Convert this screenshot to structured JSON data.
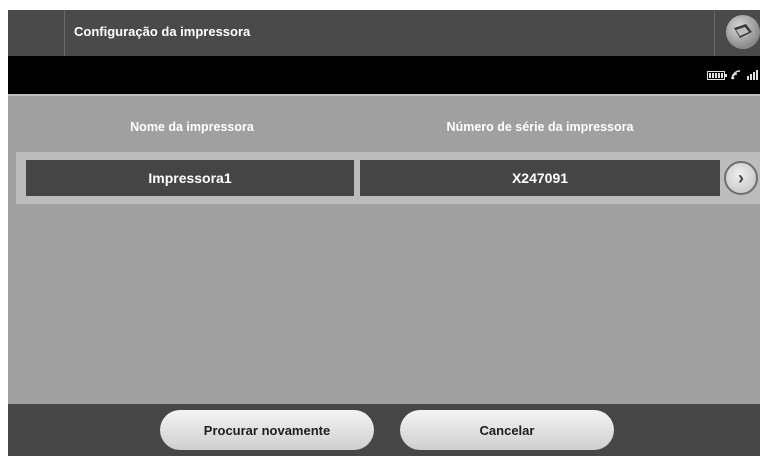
{
  "header": {
    "title": "Configuração da impressora",
    "magnet_button_icon": "wand-icon"
  },
  "statusbar": {
    "icons": [
      "battery-icon",
      "telemetry-icon",
      "signal-icon"
    ]
  },
  "table": {
    "columns": [
      "Nome da impressora",
      "Número de série da impressora"
    ],
    "rows": [
      {
        "name": "Impressora1",
        "serial": "X247091"
      }
    ]
  },
  "footer": {
    "retry_label": "Procurar novamente",
    "cancel_label": "Cancelar"
  }
}
